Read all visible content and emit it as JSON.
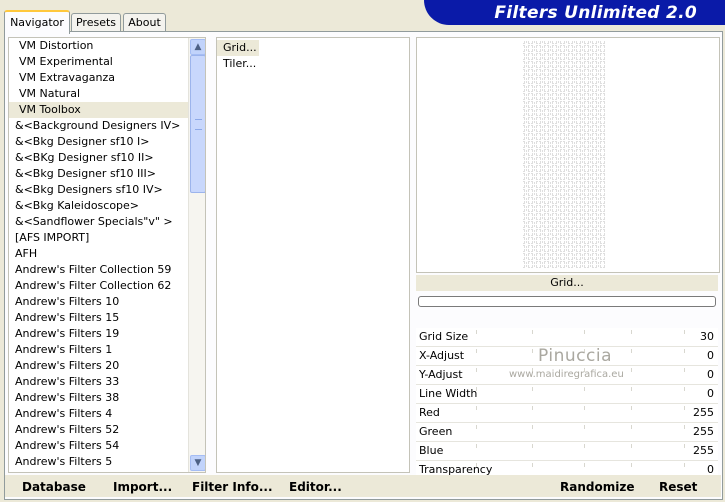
{
  "tabs": [
    "Navigator",
    "Presets",
    "About"
  ],
  "brand": "Filters Unlimited 2.0",
  "categories": [
    "VM Distortion",
    "VM Experimental",
    "VM Extravaganza",
    "VM Natural",
    "VM Toolbox",
    "&<Background Designers IV>",
    "&<Bkg Designer sf10 I>",
    "&<BKg Designer sf10 II>",
    "&<Bkg Designer sf10 III>",
    "&<Bkg Designers sf10 IV>",
    "&<Bkg Kaleidoscope>",
    "&<Sandflower Specials\"v\" >",
    "[AFS IMPORT]",
    "AFH",
    "Andrew's Filter Collection 59",
    "Andrew's Filter Collection 62",
    "Andrew's Filters 10",
    "Andrew's Filters 15",
    "Andrew's Filters 19",
    "Andrew's Filters 1",
    "Andrew's Filters 20",
    "Andrew's Filters 33",
    "Andrew's Filters 38",
    "Andrew's Filters 4",
    "Andrew's Filters 52",
    "Andrew's Filters 54",
    "Andrew's Filters 5"
  ],
  "selected_category": "VM Toolbox",
  "filters": [
    "Grid...",
    "Tiler..."
  ],
  "selected_filter": "Grid...",
  "current_filter_name": "Grid...",
  "params": [
    {
      "label": "Grid Size",
      "value": "30"
    },
    {
      "label": "X-Adjust",
      "value": "0"
    },
    {
      "label": "Y-Adjust",
      "value": "0"
    },
    {
      "label": "Line Width",
      "value": "0"
    },
    {
      "label": "Red",
      "value": "255"
    },
    {
      "label": "Green",
      "value": "255"
    },
    {
      "label": "Blue",
      "value": "255"
    },
    {
      "label": "Transparency",
      "value": "0"
    }
  ],
  "watermark": {
    "name": "Pinuccia",
    "url": "www.maidiregrafica.eu"
  },
  "buttons": {
    "database": "Database",
    "import": "Import...",
    "filter_info": "Filter Info...",
    "editor": "Editor...",
    "randomize": "Randomize",
    "reset": "Reset"
  },
  "colors": {
    "brand_bg": "#0a1aa8",
    "window_bg": "#ece9d8",
    "tab_highlight": "#ffc83c"
  }
}
